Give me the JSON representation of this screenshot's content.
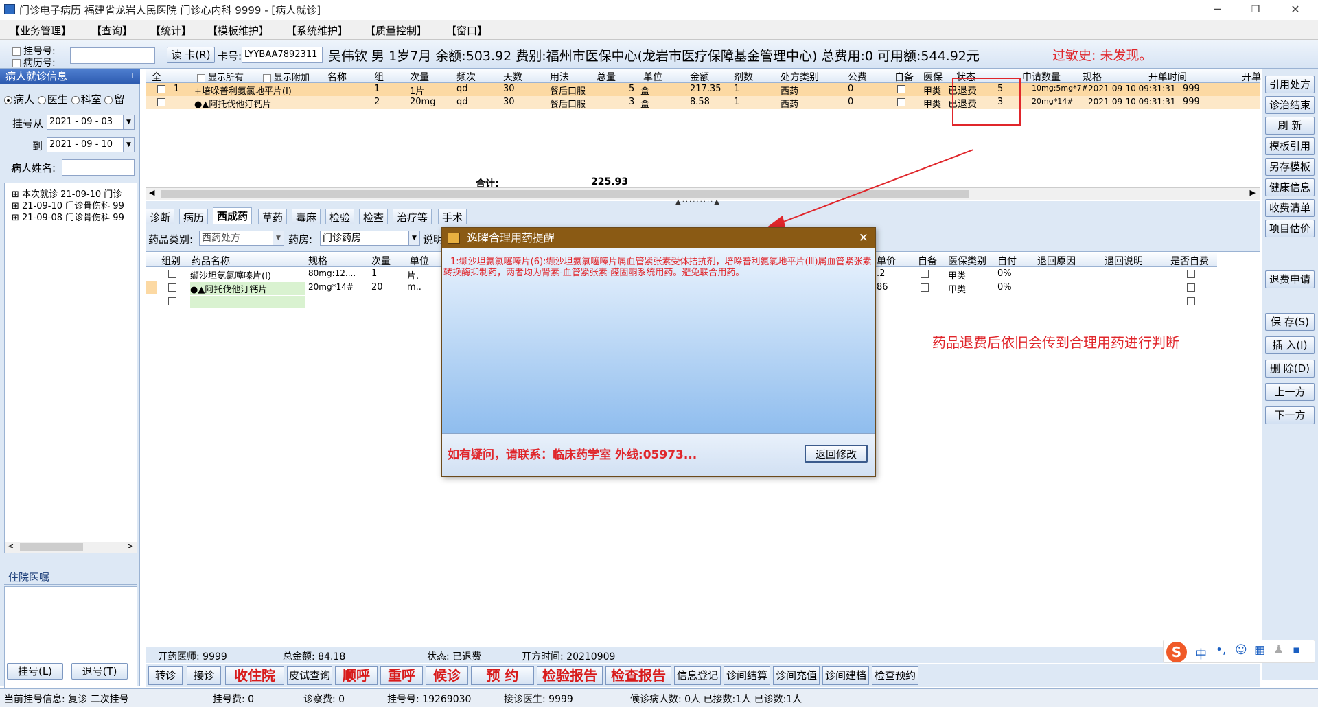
{
  "window": {
    "title": "门诊电子病历  福建省龙岩人民医院  门诊心内科  9999 - [病人就诊]",
    "min": "─",
    "restore": "❐",
    "close": "✕"
  },
  "menu": [
    "【业务管理】",
    "【查询】",
    "【统计】",
    "【模板维护】",
    "【系统维护】",
    "【质量控制】",
    "【窗口】"
  ],
  "infobar": {
    "reg_label": "挂号号:",
    "record_label": "病历号:",
    "read_card": "读 卡(R)",
    "card_label": "卡号:",
    "card_no": "LYYBAA7892311",
    "patient_info": "吴伟钦  男   1岁7月  余额:503.92  费别:福州市医保中心(龙岩市医疗保障基金管理中心) 总费用:0  可用额:544.92元",
    "allergy": "过敏史: 未发现。"
  },
  "left": {
    "header": "病人就诊信息",
    "pin": "📌",
    "radios": [
      "病人",
      "医生",
      "科室",
      "留"
    ],
    "from_label": "挂号从",
    "from_date": "2021 - 09 - 03",
    "to_label": "到",
    "to_date": "2021 - 09 - 10",
    "name_label": "病人姓名:",
    "tree": [
      "本次就诊 21-09-10 门诊",
      "21-09-10 门诊骨伤科 99",
      "21-09-08 门诊骨伤科 99"
    ],
    "inpatient": "住院医嘱",
    "reg_btn": "挂号(L)",
    "unreg_btn": "退号(T)"
  },
  "top_grid": {
    "headers": [
      "全",
      "显示所有",
      "显示附加",
      "名称",
      "组",
      "次量",
      "频次",
      "天数",
      "用法",
      "总量",
      "单位",
      "金额",
      "剂数",
      "处方类别",
      "公费",
      "自备",
      "医保",
      "状态",
      "申请数量",
      "规格",
      "开单时间",
      "开单"
    ],
    "rows": [
      {
        "no": "1",
        "name": "+培哚普利氨氯地平片(Ⅰ)",
        "group": "1",
        "dose": "1片",
        "freq": "qd",
        "days": "30",
        "usage": "餐后口服",
        "total": "5",
        "unit": "盒",
        "amount": "217.35",
        "packs": "1",
        "type": "西药",
        "public": "0",
        "ins": "甲类",
        "status": "已退费",
        "apply": "5",
        "spec": "10mg:5mg*7#",
        "time": "2021-09-10 09:31:31",
        "doc": "999"
      },
      {
        "no": "",
        "name": "●▲阿托伐他汀钙片",
        "group": "2",
        "dose": "20mg",
        "freq": "qd",
        "days": "30",
        "usage": "餐后口服",
        "total": "3",
        "unit": "盒",
        "amount": "8.58",
        "packs": "1",
        "type": "西药",
        "public": "0",
        "ins": "甲类",
        "status": "已退费",
        "apply": "3",
        "spec": "20mg*14#",
        "time": "2021-09-10 09:31:31",
        "doc": "999"
      }
    ],
    "total_label": "合计:",
    "total_value": "225.93"
  },
  "tabs": [
    "诊断",
    "病历",
    "西成药",
    "草药",
    "毒麻",
    "检验",
    "检查",
    "治疗等",
    "手术"
  ],
  "filter": {
    "cat_label": "药品类别:",
    "cat_value": "西药处方",
    "pharm_label": "药房:",
    "pharm_value": "门诊药房",
    "note_label": "说明"
  },
  "lower_grid": {
    "headers_left": [
      "组别",
      "药品名称",
      "规格",
      "次量",
      "单位"
    ],
    "headers_right": [
      "单价",
      "自备",
      "医保类别",
      "自付",
      "退回原因",
      "退回说明",
      "是否自费"
    ],
    "rows": [
      {
        "name": "缬沙坦氨氯噻嗪片(Ⅰ)",
        "spec": "80mg:12....",
        "dose": "1",
        "unit": "片.",
        "price": ".2",
        "ins": "甲类",
        "self": "0%"
      },
      {
        "name": "●▲阿托伐他汀钙片",
        "spec": "20mg*14#",
        "dose": "20",
        "unit": "m..",
        "price": "86",
        "ins": "甲类",
        "self": "0%"
      }
    ]
  },
  "annotation": "药品退费后依旧会传到合理用药进行判断",
  "dialog": {
    "title": "逸曜合理用药提醒",
    "close": "✕",
    "message": "1:缬沙坦氨氯噻嗪片(6):缬沙坦氨氯噻嗪片属血管紧张素受体拮抗剂，培哚普利氨氯地平片(Ⅲ)属血管紧张素转换酶抑制药，两者均为肾素-血管紧张素-醛固酮系统用药。避免联合用药。",
    "contact": "如有疑问，请联系：临床药学室 外线:05973...",
    "return_btn": "返回修改"
  },
  "right_buttons": [
    "引用处方",
    "诊治结束",
    "刷 新",
    "模板引用",
    "另存模板",
    "健康信息",
    "收费清单",
    "项目估价",
    "退费申请",
    "保 存(S)",
    "插 入(I)",
    "删 除(D)",
    "上一方",
    "下一方"
  ],
  "status_row": {
    "doctor": "开药医师: 9999",
    "amount": "总金额: 84.18",
    "state": "状态: 已退费",
    "time": "开方时间: 20210909"
  },
  "bottom_buttons": [
    {
      "label": "转诊",
      "red": false
    },
    {
      "label": "接诊",
      "red": false
    },
    {
      "label": "收住院",
      "red": true
    },
    {
      "label": "皮试查询",
      "red": false
    },
    {
      "label": "顺呼",
      "red": true
    },
    {
      "label": "重呼",
      "red": true
    },
    {
      "label": "候诊",
      "red": true
    },
    {
      "label": "预  约",
      "red": true
    },
    {
      "label": "检验报告",
      "red": true
    },
    {
      "label": "检查报告",
      "red": true
    },
    {
      "label": "信息登记",
      "red": false
    },
    {
      "label": "诊间结算",
      "red": false
    },
    {
      "label": "诊间充值",
      "red": false
    },
    {
      "label": "诊间建档",
      "red": false
    },
    {
      "label": "检查预约",
      "red": false
    }
  ],
  "statusbar": {
    "current": "当前挂号信息:   复诊 二次挂号",
    "fee": "挂号费:  0",
    "diag_fee": "诊察费:  0",
    "reg_no": "挂号号:  19269030",
    "doctor": "接诊医生:  9999",
    "waiting": "候诊病人数: 0人  已接数:1人  已诊数:1人"
  },
  "ime": {
    "logo": "S",
    "lang": "中",
    "punct": "•,"
  },
  "colors": {
    "highlight_row": "#fcd9a3",
    "dialog_title": "#8a5a14",
    "annotation": "#e0262b",
    "selection_box": "#e0262b"
  }
}
